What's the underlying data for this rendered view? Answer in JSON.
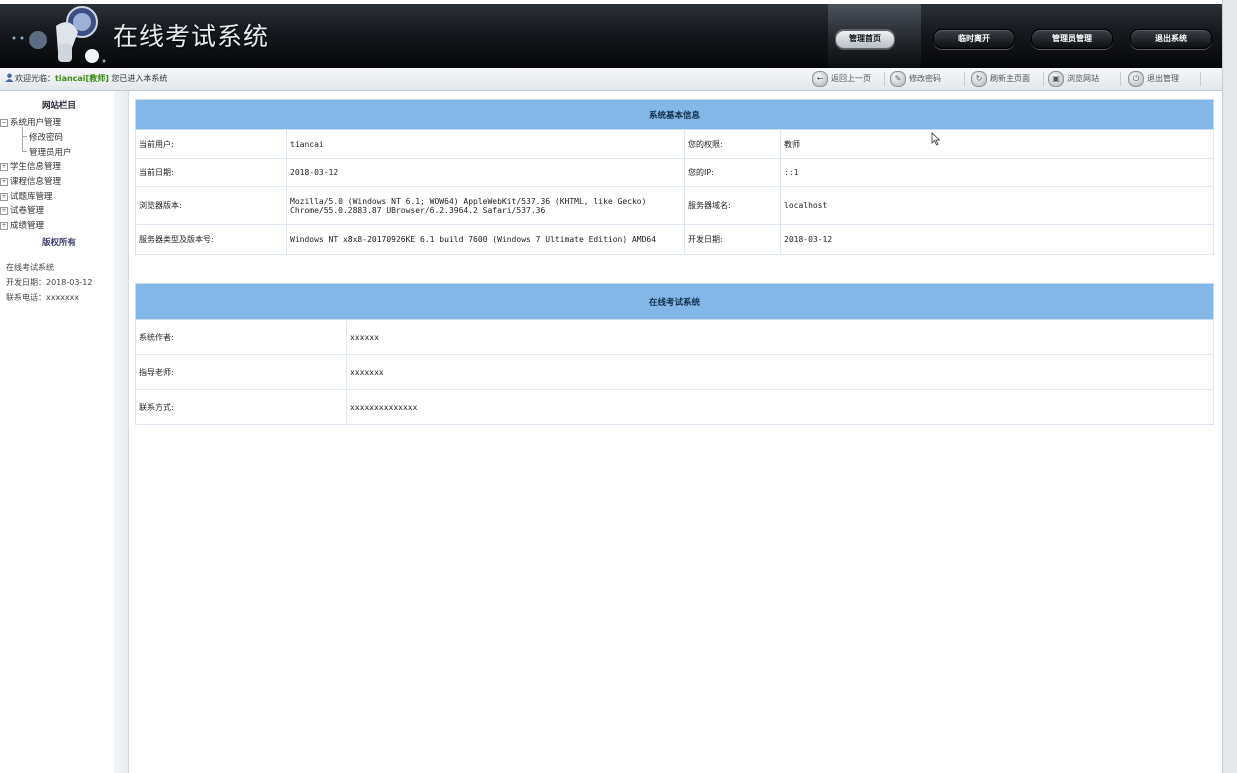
{
  "header": {
    "title": "在线考试系统",
    "nav": [
      "管理首页",
      "临时离开",
      "管理员管理",
      "退出系统"
    ],
    "active_index": 0
  },
  "welcome": {
    "prefix": "欢迎光临：",
    "user": "tiancai[教师]",
    "suffix": " 您已进入本系统"
  },
  "toolbar": [
    {
      "label": "返回上一页",
      "icon": "back-arrow-icon"
    },
    {
      "label": "修改密码",
      "icon": "edit-password-icon"
    },
    {
      "label": "刷新主页面",
      "icon": "refresh-icon"
    },
    {
      "label": "浏览网站",
      "icon": "browse-site-icon"
    },
    {
      "label": "退出管理",
      "icon": "power-icon"
    }
  ],
  "sidebar": {
    "heading": "网站栏目",
    "tree": [
      {
        "label": "系统用户管理",
        "expanded": true,
        "children": [
          "修改密码",
          "管理员用户"
        ]
      },
      {
        "label": "学生信息管理",
        "expanded": false
      },
      {
        "label": "课程信息管理",
        "expanded": false
      },
      {
        "label": "试题库管理",
        "expanded": false
      },
      {
        "label": "试卷管理",
        "expanded": false
      },
      {
        "label": "成绩管理",
        "expanded": false
      }
    ],
    "copyright": "版权所有",
    "info": [
      "在线考试系统",
      "开发日期：2018-03-12",
      "联系电话：xxxxxxx"
    ]
  },
  "sysinfo": {
    "title": "系统基本信息",
    "rows": [
      {
        "l1": "当前用户:",
        "v1": "tiancai",
        "l2": "您的权限:",
        "v2": "教师"
      },
      {
        "l1": "当前日期:",
        "v1": "2018-03-12",
        "l2": "您的IP:",
        "v2": "::1"
      },
      {
        "l1": "浏览器版本:",
        "v1a": "Mozilla/5.0 (Windows NT 6.1; WOW64) AppleWebKit/537.36 (KHTML, like Gecko)",
        "v1b": "Chrome/55.0.2883.87 UBrowser/6.2.3964.2 Safari/537.36",
        "l2": "服务器域名:",
        "v2": "localhost"
      },
      {
        "l1": "服务器类型及版本号:",
        "v1": "Windows NT x8x8-20170926KE 6.1 build 7600 (Windows 7 Ultimate Edition) AMD64",
        "l2": "开发日期:",
        "v2": "2018-03-12"
      }
    ]
  },
  "about": {
    "title": "在线考试系统",
    "rows": [
      {
        "label": "系统作者:",
        "value": "xxxxxx"
      },
      {
        "label": "指导老师:",
        "value": "xxxxxxx"
      },
      {
        "label": "联系方式:",
        "value": "xxxxxxxxxxxxxx"
      }
    ]
  }
}
